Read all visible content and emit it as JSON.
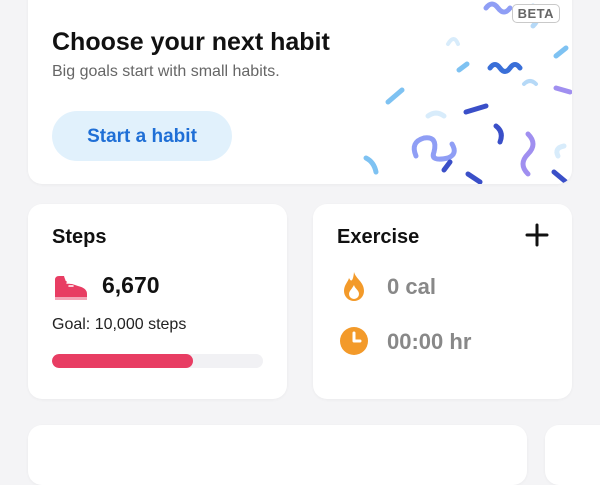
{
  "habit": {
    "badge": "BETA",
    "title": "Choose your next habit",
    "subtitle": "Big goals start with small habits.",
    "button_label": "Start a habit"
  },
  "steps": {
    "title": "Steps",
    "count": "6,670",
    "goal": "Goal: 10,000 steps",
    "progress": 0.667,
    "icon": "shoe-icon"
  },
  "exercise": {
    "title": "Exercise",
    "calories": "0 cal",
    "duration": "00:00 hr",
    "icons": [
      "plus-icon",
      "flame-icon",
      "clock-icon"
    ]
  },
  "colors": {
    "accent_blue": "#1f6fd6",
    "button_bg": "#e1f1fc",
    "steps_red": "#e83d63",
    "exercise_orange": "#f39a2a"
  }
}
